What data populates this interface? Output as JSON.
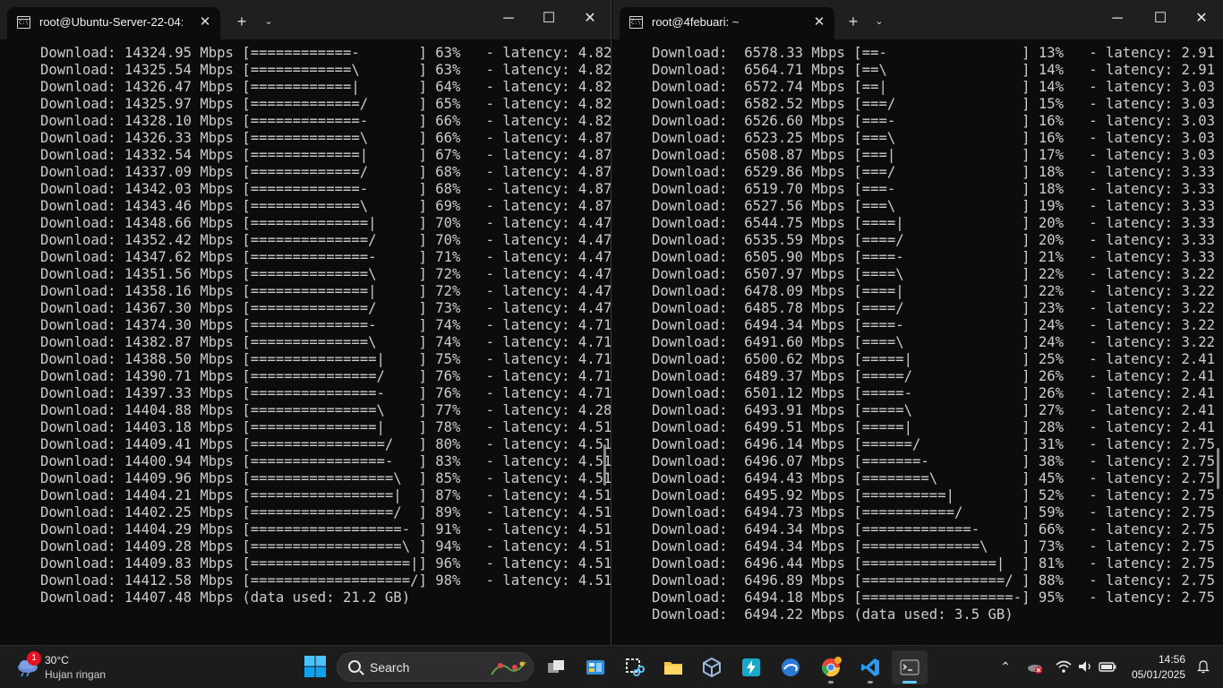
{
  "left_window": {
    "tab_title": "root@Ubuntu-Server-22-04: ~",
    "lines": [
      "Download: 14324.95 Mbps [============-       ] 63%   - latency: 4.82",
      "Download: 14325.54 Mbps [============\\       ] 63%   - latency: 4.82",
      "Download: 14326.47 Mbps [============|       ] 64%   - latency: 4.82",
      "Download: 14325.97 Mbps [=============/      ] 65%   - latency: 4.82",
      "Download: 14328.10 Mbps [=============-      ] 66%   - latency: 4.82",
      "Download: 14326.33 Mbps [=============\\      ] 66%   - latency: 4.87",
      "Download: 14332.54 Mbps [=============|      ] 67%   - latency: 4.87",
      "Download: 14337.09 Mbps [=============/      ] 68%   - latency: 4.87",
      "Download: 14342.03 Mbps [=============-      ] 68%   - latency: 4.87",
      "Download: 14343.46 Mbps [=============\\      ] 69%   - latency: 4.87",
      "Download: 14348.66 Mbps [==============|     ] 70%   - latency: 4.47",
      "Download: 14352.42 Mbps [==============/     ] 70%   - latency: 4.47",
      "Download: 14347.62 Mbps [==============-     ] 71%   - latency: 4.47",
      "Download: 14351.56 Mbps [==============\\     ] 72%   - latency: 4.47",
      "Download: 14358.16 Mbps [==============|     ] 72%   - latency: 4.47",
      "Download: 14367.30 Mbps [==============/     ] 73%   - latency: 4.47",
      "Download: 14374.30 Mbps [==============-     ] 74%   - latency: 4.71",
      "Download: 14382.87 Mbps [==============\\     ] 74%   - latency: 4.71",
      "Download: 14388.50 Mbps [===============|    ] 75%   - latency: 4.71",
      "Download: 14390.71 Mbps [===============/    ] 76%   - latency: 4.71",
      "Download: 14397.33 Mbps [===============-    ] 76%   - latency: 4.71",
      "Download: 14404.88 Mbps [===============\\    ] 77%   - latency: 4.28",
      "Download: 14403.18 Mbps [===============|    ] 78%   - latency: 4.51",
      "Download: 14409.41 Mbps [================/   ] 80%   - latency: 4.51",
      "Download: 14400.94 Mbps [================-   ] 83%   - latency: 4.51",
      "Download: 14409.96 Mbps [=================\\  ] 85%   - latency: 4.51",
      "Download: 14404.21 Mbps [=================|  ] 87%   - latency: 4.51",
      "Download: 14402.25 Mbps [=================/  ] 89%   - latency: 4.51",
      "Download: 14404.29 Mbps [==================- ] 91%   - latency: 4.51",
      "Download: 14409.28 Mbps [==================\\ ] 94%   - latency: 4.51",
      "Download: 14409.83 Mbps [===================|] 96%   - latency: 4.51",
      "Download: 14412.58 Mbps [===================/] 98%   - latency: 4.51",
      "Download: 14407.48 Mbps (data used: 21.2 GB)"
    ]
  },
  "right_window": {
    "tab_title": "root@4febuari: ~",
    "lines": [
      "Download:  6578.33 Mbps [==-                ] 13%   - latency: 2.91",
      "Download:  6564.71 Mbps [==\\                ] 14%   - latency: 2.91",
      "Download:  6572.74 Mbps [==|                ] 14%   - latency: 3.03",
      "Download:  6582.52 Mbps [===/               ] 15%   - latency: 3.03",
      "Download:  6526.60 Mbps [===-               ] 16%   - latency: 3.03",
      "Download:  6523.25 Mbps [===\\               ] 16%   - latency: 3.03",
      "Download:  6508.87 Mbps [===|               ] 17%   - latency: 3.03",
      "Download:  6529.86 Mbps [===/               ] 18%   - latency: 3.33",
      "Download:  6519.70 Mbps [===-               ] 18%   - latency: 3.33",
      "Download:  6527.56 Mbps [===\\               ] 19%   - latency: 3.33",
      "Download:  6544.75 Mbps [====|              ] 20%   - latency: 3.33",
      "Download:  6535.59 Mbps [====/              ] 20%   - latency: 3.33",
      "Download:  6505.90 Mbps [====-              ] 21%   - latency: 3.33",
      "Download:  6507.97 Mbps [====\\              ] 22%   - latency: 3.22",
      "Download:  6478.09 Mbps [====|              ] 22%   - latency: 3.22",
      "Download:  6485.78 Mbps [====/              ] 23%   - latency: 3.22",
      "Download:  6494.34 Mbps [====-              ] 24%   - latency: 3.22",
      "Download:  6491.60 Mbps [====\\              ] 24%   - latency: 3.22",
      "Download:  6500.62 Mbps [=====|             ] 25%   - latency: 2.41",
      "Download:  6489.37 Mbps [=====/             ] 26%   - latency: 2.41",
      "Download:  6501.12 Mbps [=====-             ] 26%   - latency: 2.41",
      "Download:  6493.91 Mbps [=====\\             ] 27%   - latency: 2.41",
      "Download:  6499.51 Mbps [=====|             ] 28%   - latency: 2.41",
      "Download:  6496.14 Mbps [======/            ] 31%   - latency: 2.75",
      "Download:  6496.07 Mbps [=======-           ] 38%   - latency: 2.75",
      "Download:  6494.43 Mbps [========\\          ] 45%   - latency: 2.75",
      "Download:  6495.92 Mbps [==========|        ] 52%   - latency: 2.75",
      "Download:  6494.73 Mbps [===========/       ] 59%   - latency: 2.75",
      "Download:  6494.34 Mbps [=============-     ] 66%   - latency: 2.75",
      "Download:  6494.34 Mbps [==============\\    ] 73%   - latency: 2.75",
      "Download:  6496.44 Mbps [================|  ] 81%   - latency: 2.75",
      "Download:  6496.89 Mbps [=================/ ] 88%   - latency: 2.75",
      "Download:  6494.18 Mbps [==================-] 95%   - latency: 2.75",
      "Download:  6494.22 Mbps (data used: 3.5 GB)"
    ]
  },
  "titlebar_icons": {
    "new_tab": "plus-icon",
    "dropdown": "chevron-down-icon",
    "minimize": "minimize-icon",
    "maximize": "maximize-icon",
    "close": "close-icon"
  },
  "taskbar": {
    "weather": {
      "badge": "1",
      "temp": "30°C",
      "desc": "Hujan ringan"
    },
    "search_placeholder": "Search",
    "apps": [
      "task-view-icon",
      "control-panel-icon",
      "snipping-tool-icon",
      "file-explorer-icon",
      "virtualbox-icon",
      "power-automate-icon",
      "edge-icon",
      "chrome-icon",
      "vscode-icon",
      "terminal-icon"
    ],
    "clock": {
      "time": "14:56",
      "date": "05/01/2025"
    }
  },
  "colors": {
    "terminal_bg": "#0c0c0c",
    "terminal_fg": "#cccccc",
    "titlebar_bg": "#1f1f1f",
    "taskbar_bg": "#1c1c1c",
    "accent": "#60cdff"
  }
}
